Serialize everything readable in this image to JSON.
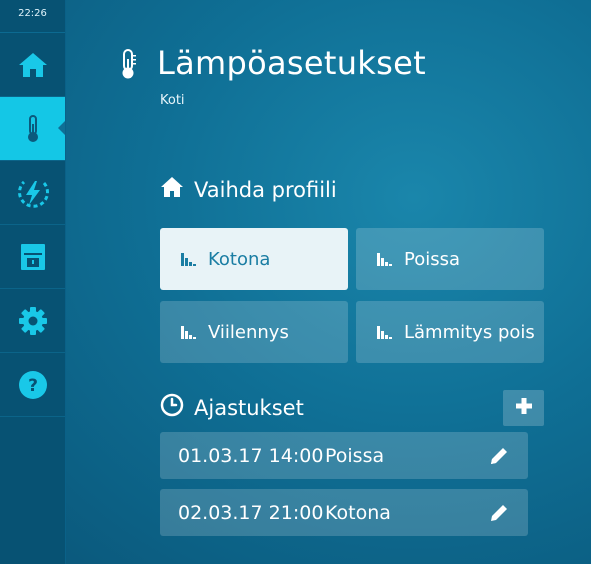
{
  "status_bar": {
    "time": "22:26"
  },
  "sidebar": {
    "items": [
      {
        "id": "home",
        "icon": "home-icon",
        "active": false
      },
      {
        "id": "heating",
        "icon": "thermometer-icon",
        "active": true
      },
      {
        "id": "energy",
        "icon": "energy-bolt-icon",
        "active": false
      },
      {
        "id": "appliance",
        "icon": "appliance-icon",
        "active": false
      },
      {
        "id": "settings",
        "icon": "gear-icon",
        "active": false
      },
      {
        "id": "help",
        "icon": "help-icon",
        "active": false
      }
    ]
  },
  "header": {
    "title": "Lämpöasetukset",
    "subtitle": "Koti"
  },
  "profiles": {
    "heading": "Vaihda profiili",
    "items": [
      {
        "label": "Kotona",
        "selected": true
      },
      {
        "label": "Poissa",
        "selected": false
      },
      {
        "label": "Viilennys",
        "selected": false
      },
      {
        "label": "Lämmitys pois",
        "selected": false
      }
    ]
  },
  "schedules": {
    "heading": "Ajastukset",
    "items": [
      {
        "datetime": "01.03.17 14:00",
        "profile": "Poissa"
      },
      {
        "datetime": "02.03.17 21:00",
        "profile": "Kotona"
      }
    ]
  },
  "colors": {
    "accent": "#14c7e6",
    "sidebar": "#075273",
    "background": "#0f6f95",
    "selected_button": "#e8f3f7",
    "selected_text": "#1a7da3"
  }
}
